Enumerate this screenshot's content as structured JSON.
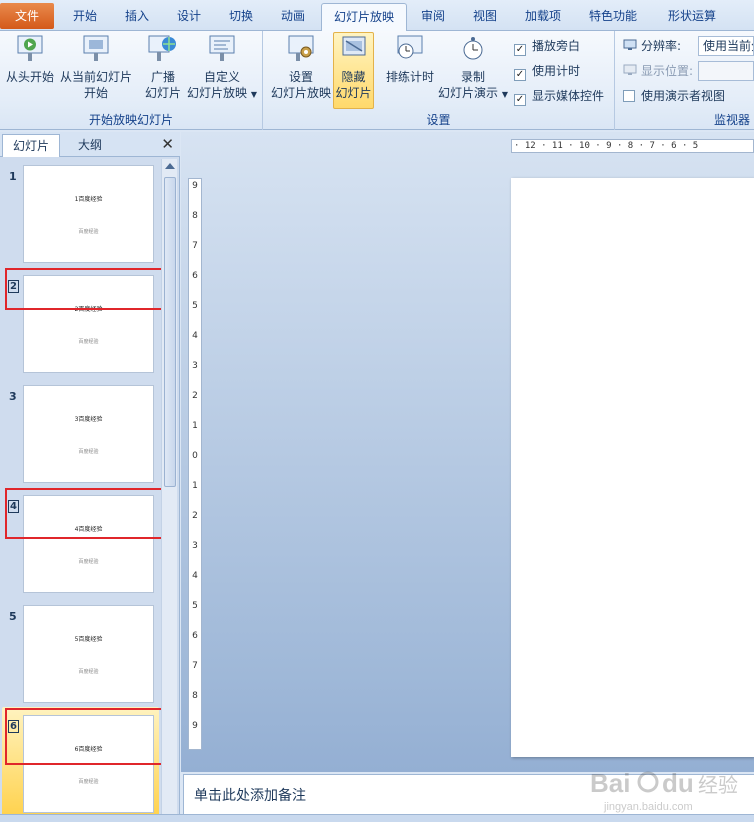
{
  "tabs": [
    "文件",
    "开始",
    "插入",
    "设计",
    "切换",
    "动画",
    "幻灯片放映",
    "审阅",
    "视图",
    "加载项",
    "特色功能",
    "形状运算"
  ],
  "active_tab": "幻灯片放映",
  "ribbon": {
    "group_start": {
      "label": "开始放映幻灯片",
      "from_beginning": "从头开始",
      "from_current_line1": "从当前幻灯片",
      "from_current_line2": "开始",
      "broadcast_line1": "广播",
      "broadcast_line2": "幻灯片",
      "custom_line1": "自定义",
      "custom_line2": "幻灯片放映"
    },
    "group_setup": {
      "label": "设置",
      "setup_show_line1": "设置",
      "setup_show_line2": "幻灯片放映",
      "hide_slide_line1": "隐藏",
      "hide_slide_line2": "幻灯片",
      "rehearse": "排练计时",
      "record_line1": "录制",
      "record_line2": "幻灯片演示",
      "play_narrations": "播放旁白",
      "use_timings": "使用计时",
      "show_media_controls": "显示媒体控件"
    },
    "group_monitors": {
      "label": "监视器",
      "resolution_label": "分辨率:",
      "resolution_value": "使用当前分",
      "show_on_label": "显示位置:",
      "presenter_view": "使用演示者视图"
    }
  },
  "panel": {
    "tab_slides": "幻灯片",
    "tab_outline": "大纲",
    "slides": [
      {
        "num": "1",
        "title": "1百度经验",
        "subtitle": "百度经验"
      },
      {
        "num": "2",
        "title": "2百度经验",
        "subtitle": "百度经验"
      },
      {
        "num": "3",
        "title": "3百度经验",
        "subtitle": "百度经验"
      },
      {
        "num": "4",
        "title": "4百度经验",
        "subtitle": "百度经验"
      },
      {
        "num": "5",
        "title": "5百度经验",
        "subtitle": "百度经验"
      },
      {
        "num": "6",
        "title": "6百度经验",
        "subtitle": "百度经验"
      }
    ]
  },
  "ruler": {
    "horizontal": "· 12 · 11 · 10 · 9 · 8 · 7 · 6 · 5",
    "vertical": [
      "9",
      "8",
      "7",
      "6",
      "5",
      "4",
      "3",
      "2",
      "1",
      "0",
      "1",
      "2",
      "3",
      "4",
      "5",
      "6",
      "7",
      "8",
      "9"
    ]
  },
  "notes_placeholder": "单击此处添加备注",
  "watermark_text": "Bai du 经验",
  "watermark_url": "jingyan.baidu.com",
  "colors": {
    "file_tab": "#d4591a",
    "highlight": "#ffd24d",
    "annotation_box": "#e0262b"
  }
}
